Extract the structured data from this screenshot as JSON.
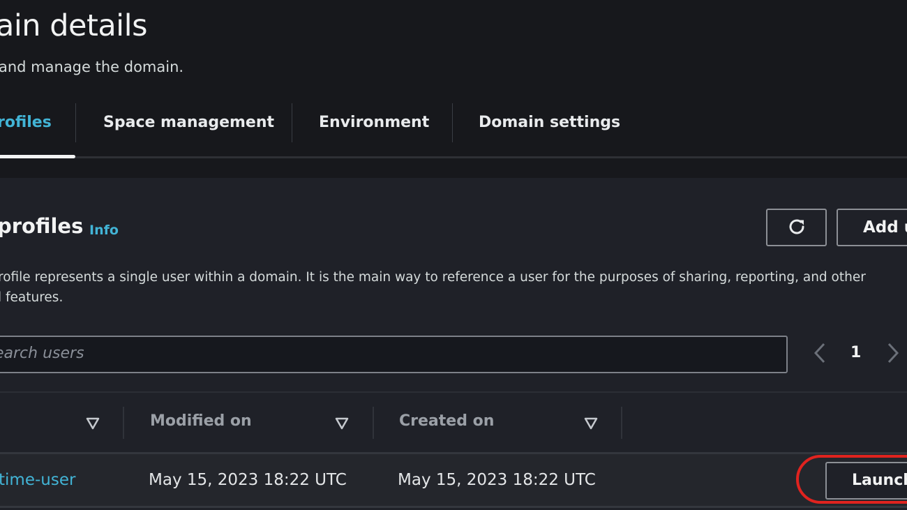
{
  "header": {
    "title": "ain details",
    "subtitle": "and manage the domain."
  },
  "tabs": [
    {
      "label": "rofiles",
      "active": true
    },
    {
      "label": "Space management",
      "active": false
    },
    {
      "label": "Environment",
      "active": false
    },
    {
      "label": "Domain settings",
      "active": false
    }
  ],
  "section": {
    "title": "profiles",
    "info_label": "Info",
    "description": "rofile represents a single user within a domain. It is the main way to reference a user for the purposes of sharing, reporting, and other",
    "description_line2": "l features.",
    "refresh_icon": "refresh-icon",
    "add_button_label": "Add u"
  },
  "search": {
    "placeholder": "earch users",
    "value": ""
  },
  "pagination": {
    "current_page": "1",
    "prev_icon": "chevron-left-icon",
    "next_icon": "chevron-right-icon"
  },
  "table": {
    "columns": [
      {
        "label": "",
        "sortable": true
      },
      {
        "label": "Modified on",
        "sortable": true
      },
      {
        "label": "Created on",
        "sortable": true
      }
    ],
    "rows": [
      {
        "name": "time-user",
        "modified_on": "May 15, 2023 18:22 UTC",
        "created_on": "May 15, 2023 18:22 UTC",
        "action_label": "Launch"
      }
    ]
  },
  "colors": {
    "accent": "#42b4d6",
    "highlight": "#e0231f",
    "background": "#17181c",
    "card": "#1f2128"
  }
}
